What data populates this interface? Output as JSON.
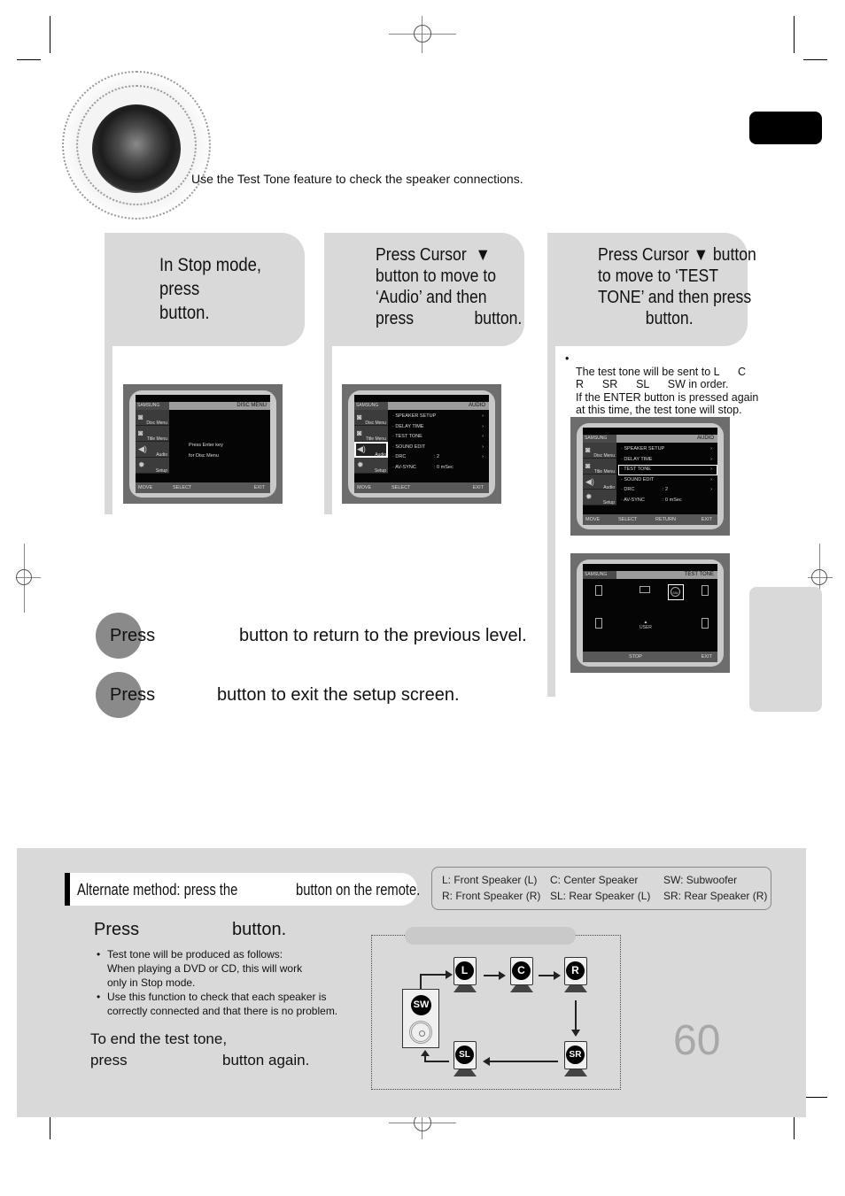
{
  "header": {
    "intro": "Use the Test Tone feature to check the speaker connections."
  },
  "steps": [
    {
      "lines": [
        "In Stop mode,",
        "press",
        "button."
      ]
    },
    {
      "lines": [
        "Press Cursor  ▼",
        "button to move to",
        "‘Audio’ and then",
        "press              button."
      ]
    },
    {
      "lines": [
        "Press Cursor ▼ button",
        "to move to ‘TEST",
        "TONE’ and then press",
        "           button."
      ],
      "note_lines": [
        "The test tone will be sent to L      C",
        "R      SR      SL      SW in order.",
        "If the ENTER button is pressed again",
        "at this time, the test tone will stop."
      ]
    }
  ],
  "screens": {
    "disc_menu": {
      "brand": "SAMSUNG",
      "title": "DISC MENU",
      "sidebar": [
        "Disc Menu",
        "Title Menu",
        "Audio",
        "Setup"
      ],
      "message": [
        "Press Enter key",
        "for Disc Menu"
      ],
      "footer": [
        "MOVE",
        "SELECT",
        "EXIT"
      ]
    },
    "audio_menu": {
      "brand": "SAMSUNG",
      "title": "AUDIO",
      "sidebar": [
        "Disc Menu",
        "Title Menu",
        "Audio",
        "Setup"
      ],
      "rows": [
        {
          "label": "SPEAKER SETUP",
          "value": "",
          "arrow": "›"
        },
        {
          "label": "DELAY TIME",
          "value": "",
          "arrow": "›"
        },
        {
          "label": "TEST TONE",
          "value": "",
          "arrow": "›"
        },
        {
          "label": "SOUND EDIT",
          "value": "",
          "arrow": "›"
        },
        {
          "label": "DRC",
          "value": ":  2",
          "arrow": "›"
        },
        {
          "label": "AV-SYNC",
          "value": ":  0 mSec",
          "arrow": ""
        }
      ],
      "footer": [
        "MOVE",
        "SELECT",
        "EXIT"
      ]
    },
    "audio_menu_test_tone": {
      "brand": "SAMSUNG",
      "title": "AUDIO",
      "footer": [
        "MOVE",
        "SELECT",
        "RETURN",
        "EXIT"
      ]
    },
    "test_tone": {
      "brand": "SAMSUNG",
      "title": "TEST TONE",
      "user_label": "USER",
      "sw_label": "SW",
      "footer": [
        "STOP",
        "EXIT"
      ]
    }
  },
  "press_lines": [
    {
      "press": "Press",
      "rest": "button to return to the previous level."
    },
    {
      "press": "Press",
      "rest": "button to exit the setup screen."
    }
  ],
  "bottom": {
    "alt_method_left": "Alternate method: press the",
    "alt_method_right": "button on the remote.",
    "legend": [
      [
        "L: Front Speaker (L)",
        "C: Center Speaker",
        "SW: Subwoofer"
      ],
      [
        "R: Front Speaker (R)",
        "SL: Rear Speaker (L)",
        "SR: Rear Speaker (R)"
      ]
    ],
    "press_left": "Press",
    "press_right": "button.",
    "bullets": [
      "Test tone will be produced as follows:\nWhen playing a DVD or CD, this will work\nonly in Stop mode.",
      "Use this function to check that each speaker is\ncorrectly connected and that there is no problem."
    ],
    "end_line1": "To end the test tone,",
    "end_press": "press",
    "end_rest": "button again.",
    "diagram": {
      "speakers": [
        "L",
        "C",
        "R",
        "SR",
        "SL",
        "SW"
      ]
    }
  },
  "page_number": "60"
}
